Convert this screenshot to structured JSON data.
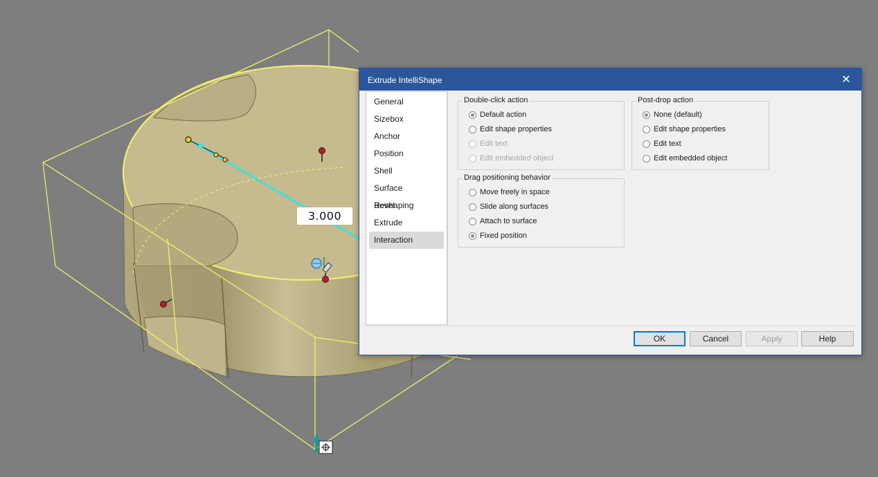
{
  "canvas": {
    "dimension_value": "3.000"
  },
  "dialog": {
    "title": "Extrude IntelliShape",
    "close_glyph": "✕",
    "nav_items": [
      {
        "label": "General"
      },
      {
        "label": "Sizebox"
      },
      {
        "label": "Anchor"
      },
      {
        "label": "Position"
      },
      {
        "label": "Shell"
      },
      {
        "label": "Surface Reshaping"
      },
      {
        "label": "Bevel"
      },
      {
        "label": "Extrude"
      },
      {
        "label": "Interaction",
        "selected": true
      }
    ],
    "double_click": {
      "legend": "Double-click action",
      "options": [
        {
          "label": "Default action",
          "checked": true,
          "enabled": true
        },
        {
          "label": "Edit shape properties",
          "checked": false,
          "enabled": true
        },
        {
          "label": "Edit text",
          "checked": false,
          "enabled": false
        },
        {
          "label": "Edit embedded object",
          "checked": false,
          "enabled": false
        }
      ]
    },
    "post_drop": {
      "legend": "Post-drop action",
      "options": [
        {
          "label": "None (default)",
          "checked": true,
          "enabled": true
        },
        {
          "label": "Edit shape properties",
          "checked": false,
          "enabled": true
        },
        {
          "label": "Edit text",
          "checked": false,
          "enabled": true
        },
        {
          "label": "Edit embedded object",
          "checked": false,
          "enabled": true
        }
      ]
    },
    "drag": {
      "legend": "Drag positioning behavior",
      "options": [
        {
          "label": "Move freely in space",
          "checked": false,
          "enabled": true
        },
        {
          "label": "Slide along surfaces",
          "checked": false,
          "enabled": true
        },
        {
          "label": "Attach to surface",
          "checked": false,
          "enabled": true
        },
        {
          "label": "Fixed position",
          "checked": true,
          "enabled": true
        }
      ]
    },
    "buttons": {
      "ok": "OK",
      "cancel": "Cancel",
      "apply": "Apply",
      "help": "Help"
    }
  },
  "colors": {
    "viewport_bg": "#7e7e7e",
    "titlebar": "#2b579a",
    "shape_fill": "#c8bc8d",
    "sizebox_line": "#f2ef6a",
    "handle_cyan": "#3ee0e0"
  }
}
